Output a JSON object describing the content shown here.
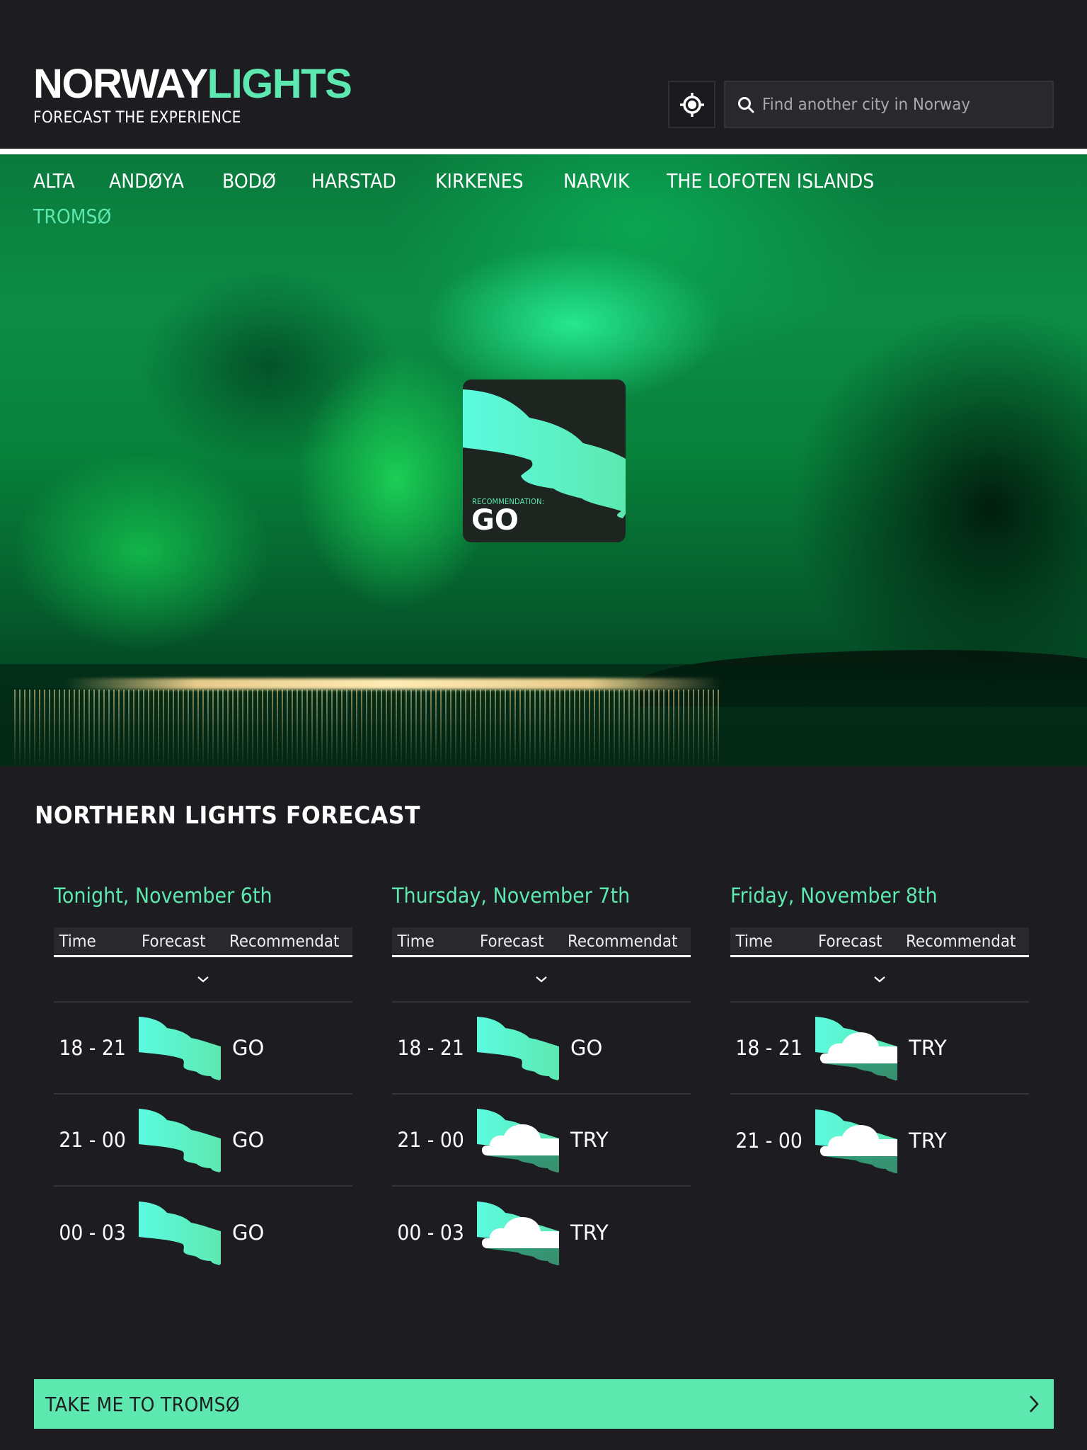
{
  "brand": {
    "name_part1": "NORWAY",
    "name_part2": "LIGHTS",
    "tagline": "FORECAST THE EXPERIENCE",
    "accent_color": "#5de8b0"
  },
  "search": {
    "placeholder": "Find another city in Norway",
    "value": ""
  },
  "icons": {
    "locate": "crosshair-locate-icon",
    "search": "search-icon",
    "expand": "chevron-down-icon",
    "cta_arrow": "chevron-right-icon",
    "aurora": "aurora-icon",
    "aurora_cloudy": "aurora-cloud-icon"
  },
  "nav": {
    "items": [
      {
        "label": "ALTA",
        "active": false
      },
      {
        "label": "ANDØYA",
        "active": false
      },
      {
        "label": "BODØ",
        "active": false
      },
      {
        "label": "HARSTAD",
        "active": false
      },
      {
        "label": "KIRKENES",
        "active": false
      },
      {
        "label": "NARVIK",
        "active": false
      },
      {
        "label": "THE LOFOTEN ISLANDS",
        "active": false
      },
      {
        "label": "TROMSØ",
        "active": true
      }
    ]
  },
  "hero": {
    "recommendation_label": "RECOMMENDATION:",
    "recommendation_value": "GO"
  },
  "forecast": {
    "title": "NORTHERN LIGHTS FORECAST",
    "columns": [
      "Time",
      "Forecast",
      "Recommendat"
    ],
    "days": [
      {
        "title": "Tonight, November 6th",
        "rows": [
          {
            "time": "18 - 21",
            "forecast": "clear",
            "recommendation": "GO"
          },
          {
            "time": "21 - 00",
            "forecast": "clear",
            "recommendation": "GO"
          },
          {
            "time": "00 - 03",
            "forecast": "clear",
            "recommendation": "GO"
          }
        ]
      },
      {
        "title": "Thursday, November 7th",
        "rows": [
          {
            "time": "18 - 21",
            "forecast": "clear",
            "recommendation": "GO"
          },
          {
            "time": "21 - 00",
            "forecast": "cloudy",
            "recommendation": "TRY"
          },
          {
            "time": "00 - 03",
            "forecast": "cloudy",
            "recommendation": "TRY"
          }
        ]
      },
      {
        "title": "Friday, November 8th",
        "rows": [
          {
            "time": "18 - 21",
            "forecast": "cloudy",
            "recommendation": "TRY"
          },
          {
            "time": "21 - 00",
            "forecast": "cloudy",
            "recommendation": "TRY"
          }
        ]
      }
    ]
  },
  "cta": {
    "label": "TAKE ME TO TROMSØ"
  }
}
